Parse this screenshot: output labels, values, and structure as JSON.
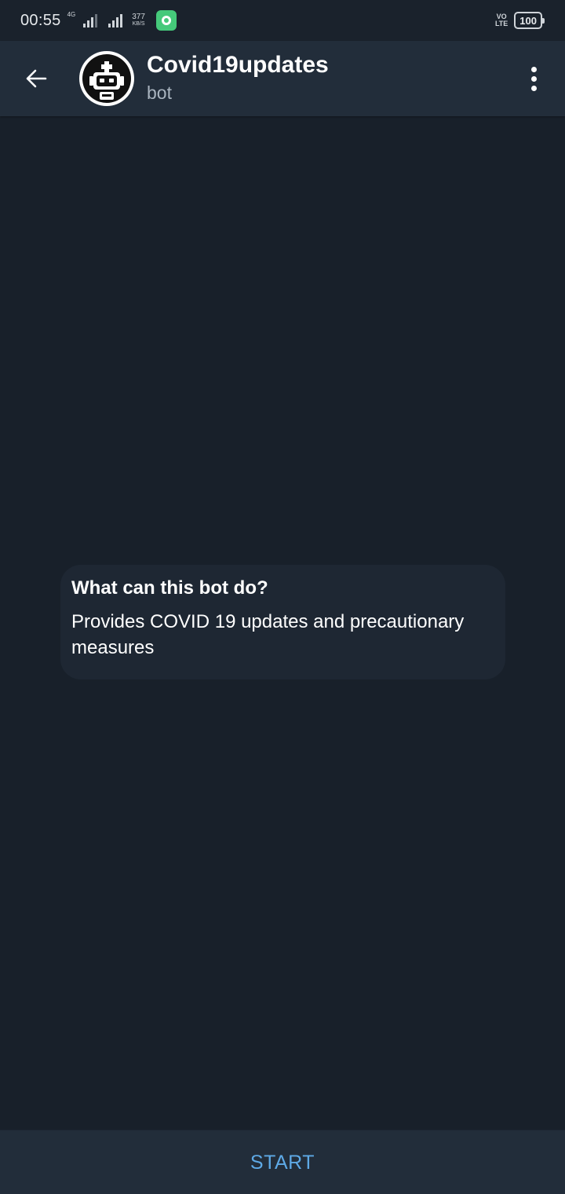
{
  "status_bar": {
    "time": "00:55",
    "network_label": "4G",
    "speed_value": "377",
    "speed_unit": "KB/S",
    "volte_top": "VO",
    "volte_bottom": "LTE",
    "battery_level": "100"
  },
  "header": {
    "title": "Covid19updates",
    "subtitle": "bot",
    "back_icon": "arrow-left-icon",
    "menu_icon": "more-vertical-icon",
    "avatar_icon": "robot-icon"
  },
  "bot_info": {
    "title": "What can this bot do?",
    "description": "Provides COVID 19 updates and precautionary measures"
  },
  "bottom_bar": {
    "start_label": "START"
  },
  "colors": {
    "background": "#18202a",
    "header": "#222d3a",
    "card": "#1e2733",
    "accent": "#5ea9e6"
  }
}
